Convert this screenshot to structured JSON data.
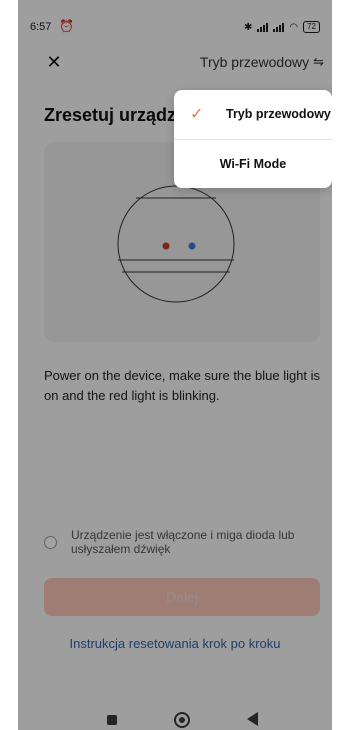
{
  "status_bar": {
    "time": "6:57",
    "alarm_icon": "alarm-clock-icon",
    "bluetooth_icon": "bluetooth-icon",
    "wifi_icon": "wifi-icon",
    "battery_level": "72"
  },
  "header": {
    "close_icon": "close-icon",
    "mode_label": "Tryb przewodowy",
    "mode_icon": "swap-icon"
  },
  "page": {
    "title": "Zresetuj urządzenie",
    "description": "Power on the device, make sure the blue light is on and the red light is blinking.",
    "confirm_label": "Urządzenie jest włączone i miga dioda lub usłyszałem dźwięk",
    "next_button_label": "Dalej",
    "reset_link": "Instrukcja resetowania krok po kroku"
  },
  "dropdown": {
    "items": [
      {
        "label": "Tryb przewodowy",
        "selected": true
      },
      {
        "label": "Wi-Fi Mode",
        "selected": false
      }
    ]
  },
  "colors": {
    "accent": "#f07050",
    "link": "#2f63a8",
    "led_red": "#c0392b",
    "led_blue": "#3a7bd5"
  }
}
